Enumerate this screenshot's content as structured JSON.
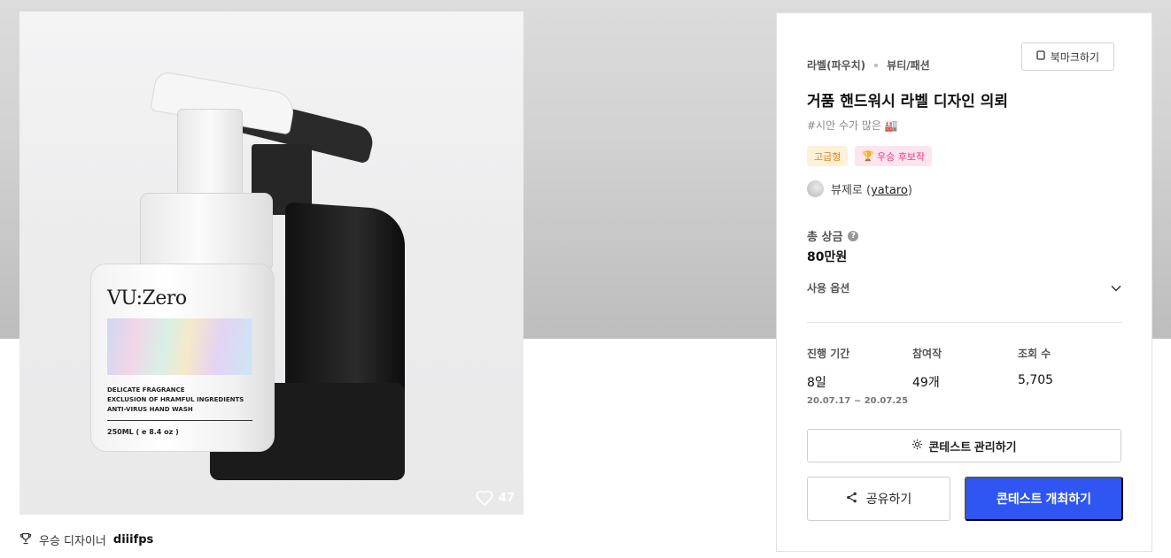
{
  "image": {
    "brand_text": "VU:Zero",
    "bottle_lines": [
      "DELICATE FRAGRANCE",
      "EXCLUSION OF HRAMFUL INGREDIENTS",
      "ANTI-VIRUS HAND WASH"
    ],
    "volume_text": "250ML ( e 8.4 oz )",
    "like_icon": "heart-icon",
    "like_count": "47"
  },
  "winner": {
    "icon": "trophy-icon",
    "label": "우승 디자이너",
    "name": "diiifps"
  },
  "panel": {
    "category_primary": "라벨(파우치)",
    "category_secondary": "뷰티/패션",
    "bookmark_icon": "bookmark-icon",
    "bookmark_label": "북마크하기",
    "title": "거품 핸드워시 라벨 디자인 의뢰",
    "subtitle": "#시안 수가 많은 🏭",
    "badges": {
      "premium": "고급형",
      "winner_candidate": "우승 후보작"
    },
    "host": {
      "name": "뷰제로",
      "paren_open": " (",
      "username": "yataro",
      "paren_close": ")"
    },
    "prize": {
      "label": "총 상금",
      "help_icon": "?",
      "value": "80만원"
    },
    "option": {
      "label": "사용 옵션",
      "icon": "chevron-down-icon"
    },
    "stats": {
      "period_label": "진행 기간",
      "period_value": "8일",
      "period_dates": "20.07.17 ~ 20.07.25",
      "entries_label": "참여작",
      "entries_value": "49개",
      "views_label": "조회 수",
      "views_value": "5,705"
    },
    "manage_label": "콘테스트 관리하기",
    "share_label": "공유하기",
    "host_contest_label": "콘테스트 개최하기"
  },
  "colors": {
    "primary_button": "#2f56f2",
    "premium_badge_text": "#e2821b",
    "winner_badge_text": "#e83a86"
  }
}
